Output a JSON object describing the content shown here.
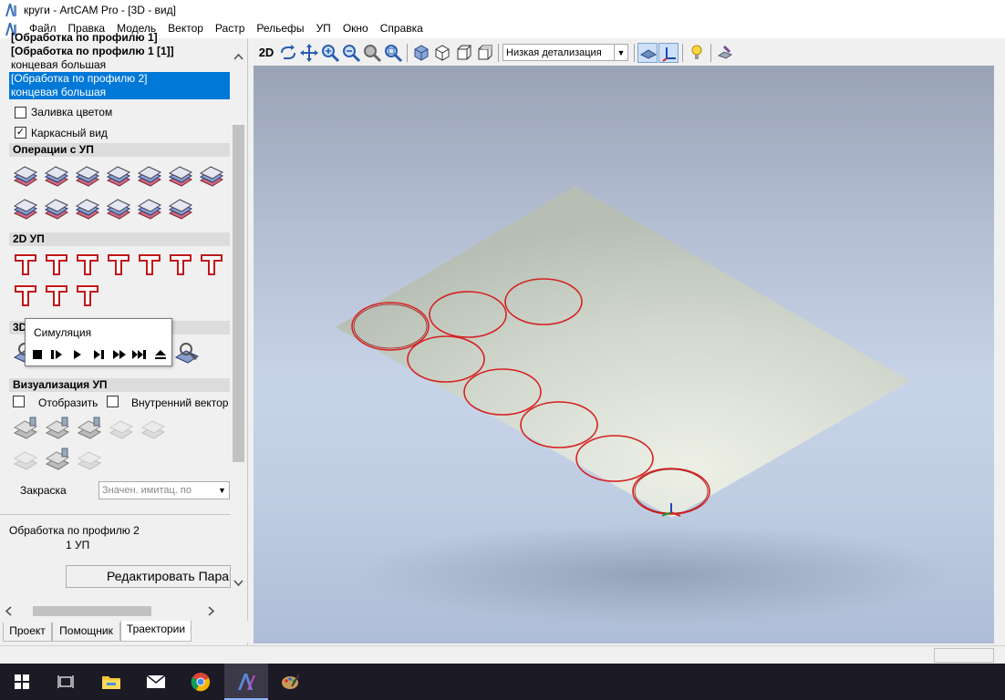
{
  "window": {
    "title": "круги - ArtCAM Pro - [3D - вид]"
  },
  "menu": [
    "Файл",
    "Правка",
    "Модель",
    "Вектор",
    "Растр",
    "Рельефы",
    "УП",
    "Окно",
    "Справка"
  ],
  "toolpath_tree": {
    "items": [
      {
        "label": "[Обработка по профилю 1]",
        "bold": true
      },
      {
        "label": "[Обработка по профилю 1 [1]]",
        "bold": true
      },
      {
        "label": "концевая большая",
        "bold": false
      },
      {
        "label": "[Обработка по профилю 2]",
        "bold": false,
        "selected": true
      },
      {
        "label": "концевая большая",
        "bold": false,
        "selected": true
      }
    ]
  },
  "options": {
    "fill_color_label": "Заливка цветом",
    "fill_color_checked": false,
    "wireframe_label": "Каркасный вид",
    "wireframe_checked": true
  },
  "sections": {
    "operations": "Операции с УП",
    "toolpaths_2d": "2D УП",
    "toolpaths_3d": "3D",
    "visualization": "Визуализация УП"
  },
  "operation_icons": [
    "save-toolpath-icon",
    "toolpath-info-icon",
    "merge-toolpath-icon",
    "toolpath-stack-icon",
    "toolpath-transform-icon",
    "toolpath-sheet-icon",
    "toolpath-table-icon",
    "save-as-toolpath-icon",
    "export-toolpath-icon",
    "toolpath-order-icon",
    "toolpath-add-icon",
    "toolpath-array-icon",
    "toolpath-template-icon"
  ],
  "tools_2d_icons": [
    "profile-machining-icon",
    "area-clearance-icon",
    "v-carve-icon",
    "bevel-carve-icon",
    "engrave-text-icon",
    "drilling-icon",
    "feature-machining-icon",
    "inlay-icon",
    "fluting-icon",
    "slotting-icon"
  ],
  "simulation_popup": {
    "title": "Симуляция",
    "controls": [
      "stop-icon",
      "step-play-icon",
      "play-icon",
      "next-icon",
      "fast-forward-icon",
      "skip-end-icon",
      "eject-icon"
    ]
  },
  "visualization": {
    "show_label": "Отобразить",
    "show_checked": false,
    "inner_vector_label": "Внутренний вектор",
    "inner_vector_checked": false,
    "shading_label": "Закраска",
    "shading_placeholder": "Значен. имитац. по"
  },
  "selected_toolpath": {
    "name": "Обработка по профилю 2",
    "count": "1 УП",
    "edit_button": "Редактировать Параметры"
  },
  "tabs": [
    "Проект",
    "Помощник",
    "Траектории"
  ],
  "active_tab": "Траектории",
  "view_toolbar": {
    "mode_2d": "2D",
    "detail_level": "Низкая детализация"
  },
  "colors": {
    "selection": "#0078d7",
    "toolpath_circle": "#d42020",
    "plane": "#d7ddd2"
  },
  "taskbar_icons": [
    "windows-start-icon",
    "task-view-icon",
    "file-explorer-icon",
    "mail-icon",
    "chrome-icon",
    "artcam-icon",
    "paint-icon"
  ]
}
